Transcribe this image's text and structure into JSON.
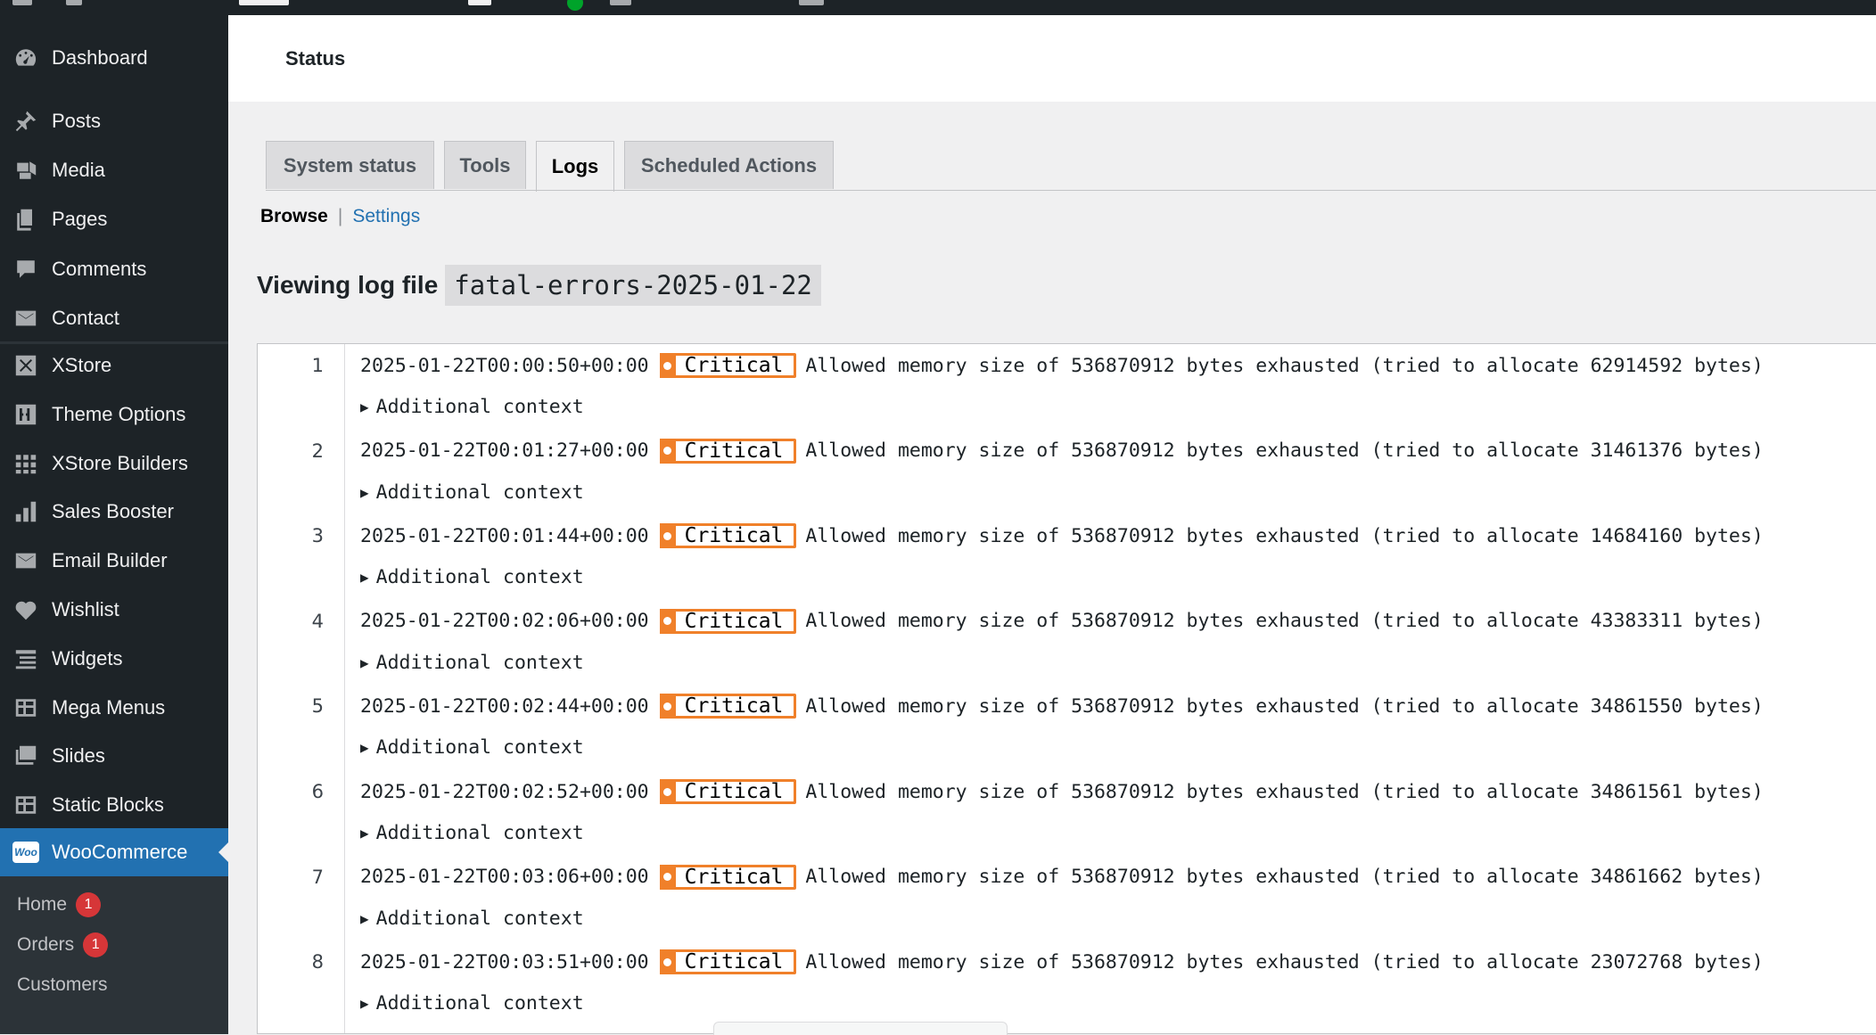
{
  "sidebar": {
    "group1": [
      {
        "label": "Dashboard",
        "icon": "dashboard-icon"
      }
    ],
    "group2": [
      {
        "label": "Posts",
        "icon": "pin-icon"
      },
      {
        "label": "Media",
        "icon": "media-icon"
      },
      {
        "label": "Pages",
        "icon": "pages-icon"
      },
      {
        "label": "Comments",
        "icon": "comment-icon"
      },
      {
        "label": "Contact",
        "icon": "envelope-icon"
      }
    ],
    "group3": [
      {
        "label": "XStore",
        "icon": "xstore-icon"
      },
      {
        "label": "Theme Options",
        "icon": "sliders-icon"
      },
      {
        "label": "XStore Builders",
        "icon": "grid-icon"
      },
      {
        "label": "Sales Booster",
        "icon": "bar-chart-icon"
      },
      {
        "label": "Email Builder",
        "icon": "envelope-icon"
      },
      {
        "label": "Wishlist",
        "icon": "heart-icon"
      },
      {
        "label": "Widgets",
        "icon": "list-icon"
      },
      {
        "label": "Mega Menus",
        "icon": "table-icon"
      },
      {
        "label": "Slides",
        "icon": "slides-icon"
      },
      {
        "label": "Static Blocks",
        "icon": "table-icon"
      }
    ],
    "woocommerce": {
      "label": "WooCommerce",
      "logo": "Woo"
    },
    "submenu": [
      {
        "label": "Home",
        "badge": "1"
      },
      {
        "label": "Orders",
        "badge": "1"
      },
      {
        "label": "Customers",
        "badge": ""
      }
    ]
  },
  "header": {
    "title": "Status"
  },
  "tabs": [
    {
      "label": "System status"
    },
    {
      "label": "Tools"
    },
    {
      "label": "Logs"
    },
    {
      "label": "Scheduled Actions"
    }
  ],
  "subnav": {
    "current": "Browse",
    "separator": "|",
    "link": "Settings"
  },
  "viewing": {
    "label": "Viewing log file",
    "file": "fatal-errors-2025-01-22"
  },
  "log": {
    "level": "Critical",
    "context_label": "Additional context",
    "entries": [
      {
        "line": "1",
        "timestamp": "2025-01-22T00:00:50+00:00",
        "message": "Allowed memory size of 536870912 bytes exhausted (tried to allocate 62914592 bytes)"
      },
      {
        "line": "2",
        "timestamp": "2025-01-22T00:01:27+00:00",
        "message": "Allowed memory size of 536870912 bytes exhausted (tried to allocate 31461376 bytes)"
      },
      {
        "line": "3",
        "timestamp": "2025-01-22T00:01:44+00:00",
        "message": "Allowed memory size of 536870912 bytes exhausted (tried to allocate 14684160 bytes)"
      },
      {
        "line": "4",
        "timestamp": "2025-01-22T00:02:06+00:00",
        "message": "Allowed memory size of 536870912 bytes exhausted (tried to allocate 43383311 bytes)"
      },
      {
        "line": "5",
        "timestamp": "2025-01-22T00:02:44+00:00",
        "message": "Allowed memory size of 536870912 bytes exhausted (tried to allocate 34861550 bytes)"
      },
      {
        "line": "6",
        "timestamp": "2025-01-22T00:02:52+00:00",
        "message": "Allowed memory size of 536870912 bytes exhausted (tried to allocate 34861561 bytes)"
      },
      {
        "line": "7",
        "timestamp": "2025-01-22T00:03:06+00:00",
        "message": "Allowed memory size of 536870912 bytes exhausted (tried to allocate 34861662 bytes)"
      },
      {
        "line": "8",
        "timestamp": "2025-01-22T00:03:51+00:00",
        "message": "Allowed memory size of 536870912 bytes exhausted (tried to allocate 23072768 bytes)"
      }
    ]
  },
  "colors": {
    "sidebar_bg": "#1d2327",
    "accent": "#2271b1",
    "critical": "#f0802a",
    "badge": "#d63638"
  }
}
